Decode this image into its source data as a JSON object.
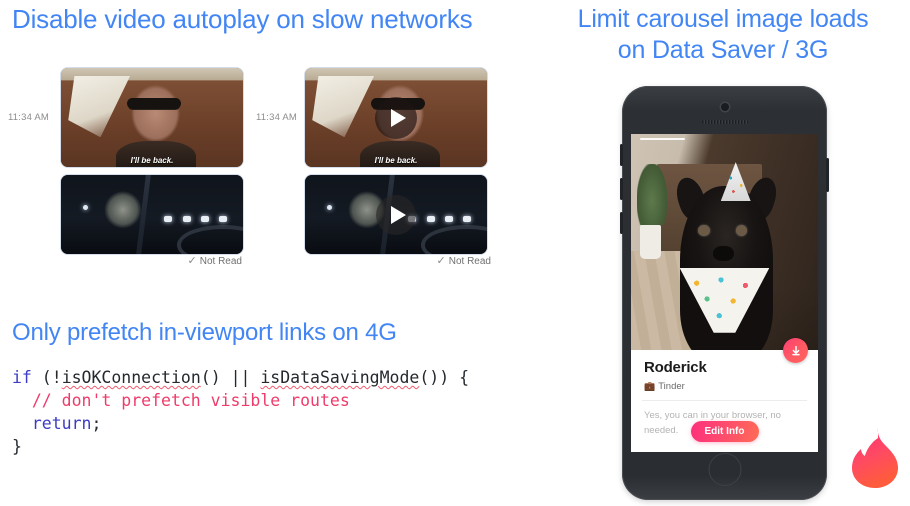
{
  "slide": {
    "background": "#ffffff",
    "accent_blue": "#4285f4",
    "tinder_pink": "#fe3c72"
  },
  "headings": {
    "left_video": "Disable video autoplay on slow networks",
    "right_carousel": "Limit carousel image loads\non Data Saver / 3G",
    "code_prefetch": "Only prefetch in-viewport links on 4G"
  },
  "chat_panels": [
    {
      "id": "autoplay-on",
      "timestamp": "11:34 AM",
      "status": "Not Read",
      "status_icon": "check-icon",
      "messages": [
        {
          "type": "gif",
          "caption": "I'll be back.",
          "has_play_overlay": false
        },
        {
          "type": "gif",
          "caption": "",
          "has_play_overlay": false
        }
      ]
    },
    {
      "id": "autoplay-off",
      "timestamp": "11:34 AM",
      "status": "Not Read",
      "status_icon": "check-icon",
      "messages": [
        {
          "type": "gif",
          "caption": "I'll be back.",
          "has_play_overlay": true
        },
        {
          "type": "gif",
          "caption": "",
          "has_play_overlay": true
        }
      ]
    }
  ],
  "code": {
    "language": "javascript",
    "lines": [
      [
        {
          "t": "if",
          "k": "kw"
        },
        {
          "t": " (!",
          "k": "pun"
        },
        {
          "t": "isOKConnection",
          "k": "ident"
        },
        {
          "t": "() || ",
          "k": "pun"
        },
        {
          "t": "isDataSavingMode",
          "k": "ident"
        },
        {
          "t": "()) {",
          "k": "pun"
        }
      ],
      [
        {
          "t": "  // don't prefetch visible routes",
          "k": "cmt"
        }
      ],
      [
        {
          "t": "  ",
          "k": "pun"
        },
        {
          "t": "return",
          "k": "kw"
        },
        {
          "t": ";",
          "k": "pun"
        }
      ],
      [
        {
          "t": "}",
          "k": "pun"
        }
      ]
    ]
  },
  "phone": {
    "device": "iphone-se-space-gray",
    "card": {
      "name": "Roderick",
      "subtitle": "Tinder",
      "subtitle_icon": "briefcase-icon",
      "body_text": "Yes, you can          in your browser, no          needed.",
      "button_label": "Edit Info",
      "badge_icon": "download-arrow-icon"
    }
  },
  "logo": {
    "name": "tinder-flame-logo",
    "gradient_from": "#ff2e74",
    "gradient_to": "#ff5b3c"
  }
}
